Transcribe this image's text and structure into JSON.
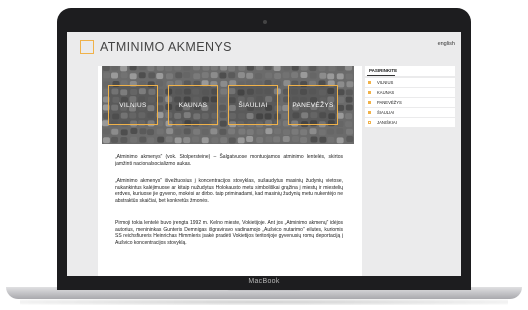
{
  "laptop": {
    "brand": "MacBook"
  },
  "header": {
    "title": "ATMINIMO AKMENYS",
    "lang": "english"
  },
  "hero": {
    "cities": [
      "VILNIUS",
      "KAUNAS",
      "ŠIAULIAI",
      "PANEVĖŽYS"
    ]
  },
  "content": {
    "paragraphs": [
      "„Atminimo akmenys“ (vok. Stolpersteine) – Šalgatvuose montuojamos atminimo lentelės, skirtos įamžinti nacionalsocializmo aukas.",
      "„Atminimo akmenys“ išvežtuosius į koncentracijos stovyklas, sušaudytus masinių žudynių vietose, nukankintus kalėjimuose ar kitaip nužudytus Holokausto metu simboliškai grąžina į miestų ir miestelių erdves, kuriuose jie gyveno, mokėsi ar dirbo. taip priminadami, kad masinių žudynių metu nukentėjo ne abstraktūs skaičiai, bet konkretūs žmonės.",
      "Pirmoji tokia lentelė buvo įrengta 1992 m. Kelno mieste, Vokietijoje. Ant jos „Atminimo akmenų“ idėjos autorius, menininkas Gunteris Demnigas išgraviravo vadinamojo „Aušvico nutarimo“ eilutes, kuriomis SS reichsfiureris Heinrichas Himmleris įsakė pradėti Vokietijos teritorijoje gyvenusių romų deportaciją į Aušvico koncentracijos stovyklą."
    ]
  },
  "sidebar": {
    "title": "PASIRINKITE",
    "items": [
      {
        "label": "VILNIUS"
      },
      {
        "label": "KAUNAS"
      },
      {
        "label": "PANEVĖŽYS"
      },
      {
        "label": "ŠIAULIAI"
      },
      {
        "label": "JANIŠKIAI"
      }
    ]
  },
  "colors": {
    "accent": "#f0b24a",
    "background": "#ebebec",
    "bezel": "#1d1d1f"
  }
}
